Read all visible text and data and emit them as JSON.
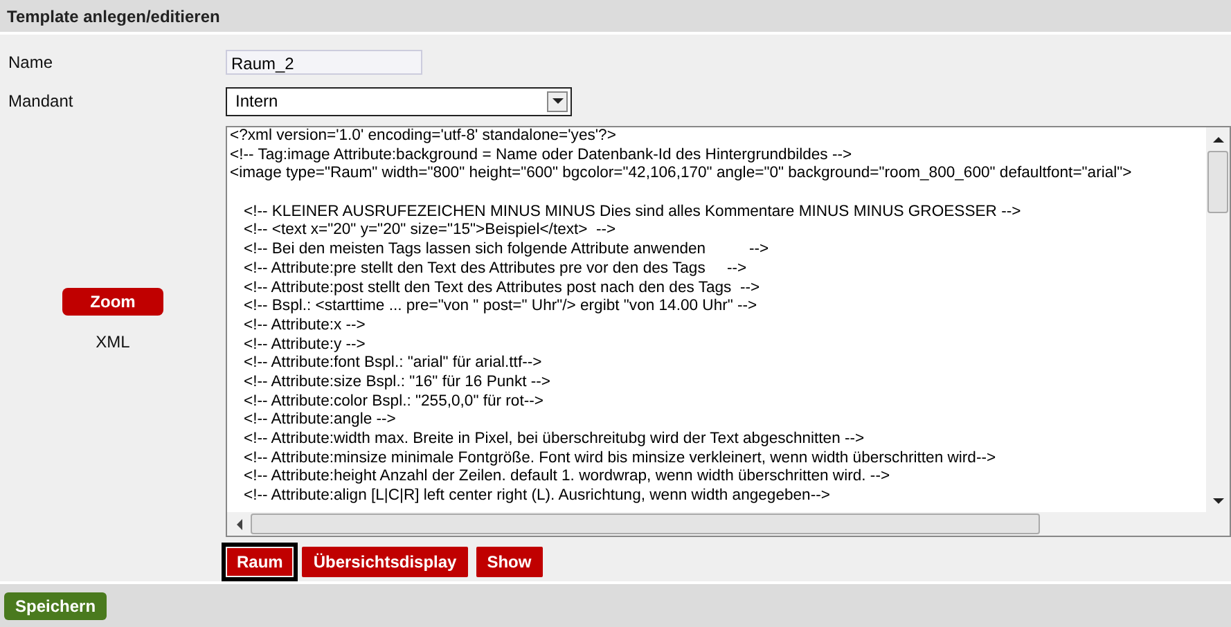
{
  "header": {
    "title": "Template anlegen/editieren"
  },
  "fields": [
    {
      "kind": "text",
      "label": "Name",
      "value": "Raum_2"
    },
    {
      "kind": "select",
      "label": "Mandant",
      "value": "Intern"
    }
  ],
  "xml": {
    "label": "XML",
    "zoom_button": "Zoom",
    "header_lines": [
      "<?xml version='1.0' encoding='utf-8' standalone='yes'?>",
      "<!-- Tag:image Attribute:background = Name oder Datenbank-Id des Hintergrundbildes -->",
      "<image type=\"Raum\" width=\"800\" height=\"600\" bgcolor=\"42,106,170\" angle=\"0\" background=\"room_800_600\" defaultfont=\"arial\">"
    ],
    "comment_lines": [
      "<!-- KLEINER AUSRUFEZEICHEN MINUS MINUS Dies sind alles Kommentare MINUS MINUS GROESSER -->",
      "<!-- <text x=\"20\" y=\"20\" size=\"15\">Beispiel</text>  -->",
      "<!-- Bei den meisten Tags lassen sich folgende Attribute anwenden          -->",
      "<!-- Attribute:pre stellt den Text des Attributes pre vor den des Tags     -->",
      "<!-- Attribute:post stellt den Text des Attributes post nach den des Tags  -->",
      "<!-- Bspl.: <starttime ... pre=\"von \" post=\" Uhr\"/> ergibt \"von 14.00 Uhr\" -->",
      "<!-- Attribute:x -->",
      "<!-- Attribute:y -->",
      "<!-- Attribute:font Bspl.: \"arial\" für arial.ttf-->",
      "<!-- Attribute:size Bspl.: \"16\" für 16 Punkt -->",
      "<!-- Attribute:color Bspl.: \"255,0,0\" für rot-->",
      "<!-- Attribute:angle -->",
      "<!-- Attribute:width max. Breite in Pixel, bei überschreitubg wird der Text abgeschnitten -->",
      "<!-- Attribute:minsize minimale Fontgröße. Font wird bis minsize verkleinert, wenn width überschritten wird-->",
      "<!-- Attribute:height Anzahl der Zeilen. default 1. wordwrap, wenn width überschritten wird. -->",
      "<!-- Attribute:align [L|C|R] left center right (L). Ausrichtung, wenn width angegeben-->"
    ]
  },
  "template_buttons": [
    {
      "label": "Raum",
      "selected": true
    },
    {
      "label": "Übersichtsdisplay",
      "selected": false
    },
    {
      "label": "Show",
      "selected": false
    }
  ],
  "footer": {
    "save_button": "Speichern"
  }
}
